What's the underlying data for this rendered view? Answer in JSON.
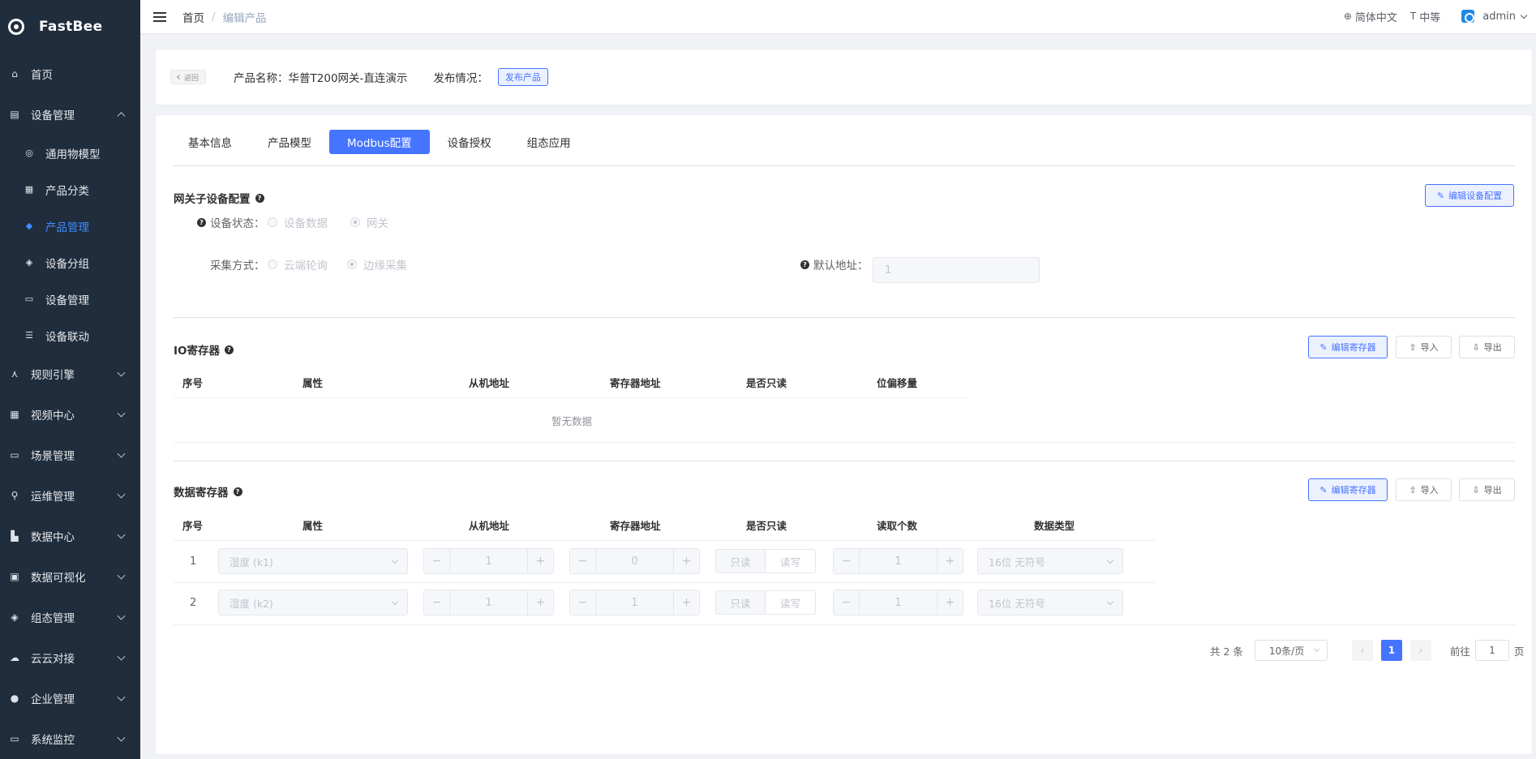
{
  "app": {
    "name": "FastBee"
  },
  "sidebar": {
    "items": [
      {
        "label": "首页",
        "icon": "home-icon"
      },
      {
        "label": "设备管理",
        "icon": "device-icon",
        "expanded": true,
        "children": [
          {
            "label": "通用物模型",
            "icon": "model-icon"
          },
          {
            "label": "产品分类",
            "icon": "category-icon"
          },
          {
            "label": "产品管理",
            "icon": "product-icon",
            "active": true
          },
          {
            "label": "设备分组",
            "icon": "group-icon"
          },
          {
            "label": "设备管理",
            "icon": "device-manage-icon"
          },
          {
            "label": "设备联动",
            "icon": "linkage-icon"
          }
        ]
      },
      {
        "label": "规则引擎",
        "icon": "rule-icon"
      },
      {
        "label": "视频中心",
        "icon": "video-icon"
      },
      {
        "label": "场景管理",
        "icon": "scene-icon"
      },
      {
        "label": "运维管理",
        "icon": "ops-icon"
      },
      {
        "label": "数据中心",
        "icon": "data-icon"
      },
      {
        "label": "数据可视化",
        "icon": "visual-icon"
      },
      {
        "label": "组态管理",
        "icon": "config-icon"
      },
      {
        "label": "云云对接",
        "icon": "cloud-icon"
      },
      {
        "label": "企业管理",
        "icon": "enterprise-icon"
      },
      {
        "label": "系统监控",
        "icon": "monitor-icon"
      }
    ]
  },
  "topbar": {
    "breadcrumb": [
      "首页",
      "编辑产品"
    ],
    "language": "简体中文",
    "size": "中等",
    "user": "admin"
  },
  "header": {
    "back_label": "返回",
    "product_label": "产品名称：",
    "product_name": "华普T200网关-直连演示",
    "publish_label": "发布情况：",
    "publish_tag": "发布产品"
  },
  "tabs": [
    {
      "label": "基本信息"
    },
    {
      "label": "产品模型"
    },
    {
      "label": "Modbus配置",
      "active": true
    },
    {
      "label": "设备授权"
    },
    {
      "label": "组态应用"
    }
  ],
  "gateway": {
    "title": "网关子设备配置",
    "edit_button": "编辑设备配置",
    "status_label": "设备状态：",
    "status_options": [
      "设备数据",
      "网关"
    ],
    "status_selected": "网关",
    "collect_label": "采集方式：",
    "collect_options": [
      "云端轮询",
      "边缘采集"
    ],
    "collect_selected": "边缘采集",
    "default_addr_label": "默认地址：",
    "default_addr_value": "1"
  },
  "io_register": {
    "title": "IO寄存器",
    "edit_button": "编辑寄存器",
    "import_button": "导入",
    "export_button": "导出",
    "columns": [
      "序号",
      "属性",
      "从机地址",
      "寄存器地址",
      "是否只读",
      "位偏移量"
    ],
    "empty_text": "暂无数据"
  },
  "data_register": {
    "title": "数据寄存器",
    "edit_button": "编辑寄存器",
    "import_button": "导入",
    "export_button": "导出",
    "columns": [
      "序号",
      "属性",
      "从机地址",
      "寄存器地址",
      "是否只读",
      "读取个数",
      "数据类型"
    ],
    "readonly_options": [
      "只读",
      "读写"
    ],
    "rows": [
      {
        "index": "1",
        "attr": "湿度 (k1)",
        "slave": "1",
        "reg": "0",
        "readonly": "只读",
        "count": "1",
        "dtype": "16位 无符号"
      },
      {
        "index": "2",
        "attr": "湿度 (k2)",
        "slave": "1",
        "reg": "1",
        "readonly": "只读",
        "count": "1",
        "dtype": "16位 无符号"
      }
    ]
  },
  "pagination": {
    "total": "共 2 条",
    "page_size": "10条/页",
    "current": "1",
    "goto_label": "前往",
    "goto_value": "1",
    "page_suffix": "页"
  },
  "colors": {
    "primary": "#4574ff",
    "sidebar_bg": "#1f2d3d",
    "active_menu": "#3f8cff"
  }
}
